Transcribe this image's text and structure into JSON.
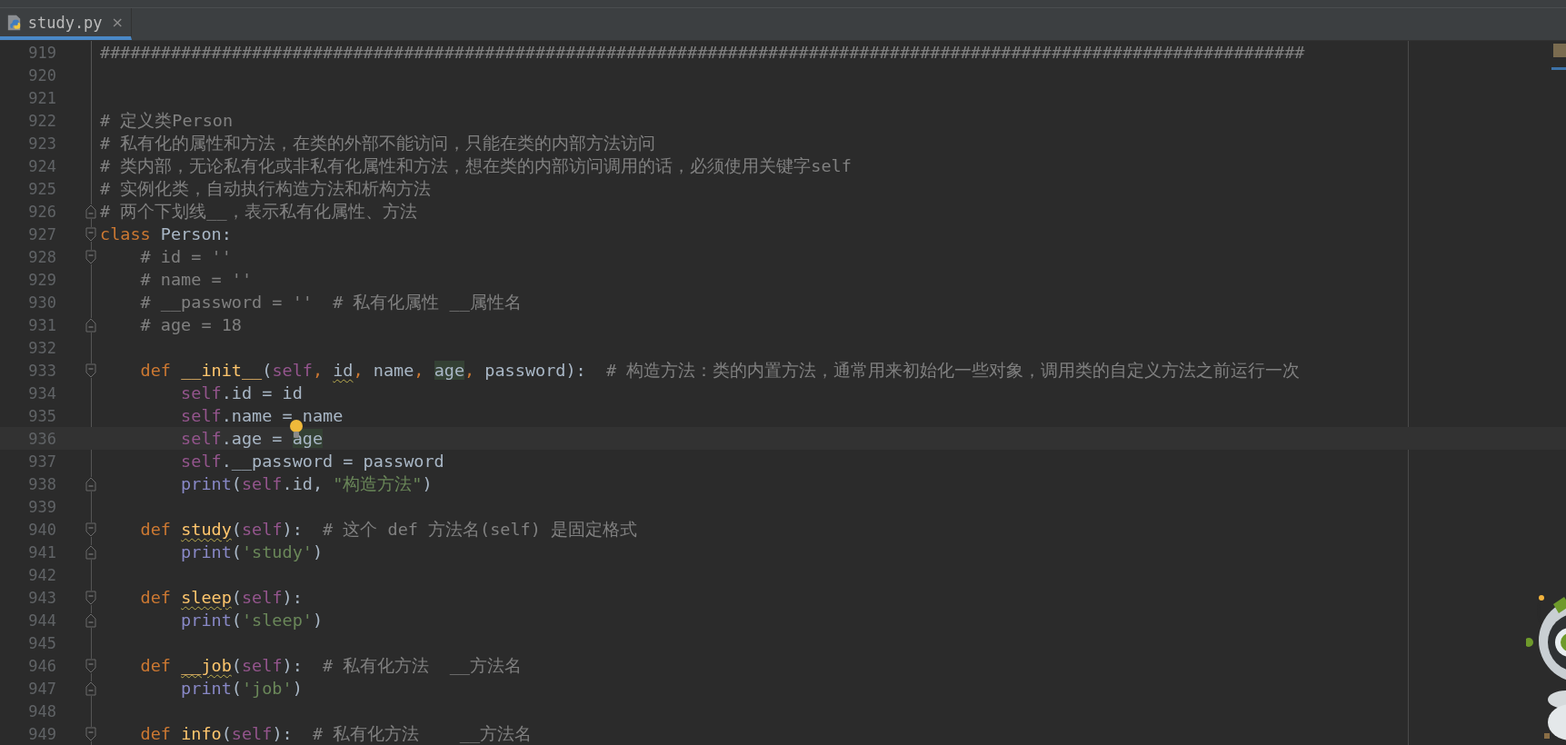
{
  "tabs": [
    {
      "label": "study.py",
      "selected": true,
      "close": "×"
    }
  ],
  "lines": [
    {
      "number": "919",
      "current": false,
      "tokens": [
        {
          "t": "#######################################################################################################################",
          "kind": "comment"
        }
      ]
    },
    {
      "number": "920",
      "current": false
    },
    {
      "number": "921",
      "current": false
    },
    {
      "number": "922",
      "current": false,
      "tokens": [
        {
          "t": "# 定义类Person",
          "kind": "comment"
        }
      ]
    },
    {
      "number": "923",
      "current": false,
      "tokens": [
        {
          "t": "# 私有化的属性和方法，在类的外部不能访问，只能在类的内部方法访问",
          "kind": "comment"
        }
      ]
    },
    {
      "number": "924",
      "current": false,
      "tokens": [
        {
          "t": "# 类内部，无论私有化或非私有化属性和方法，想在类的内部访问调用的话，必须使用关键字self",
          "kind": "comment"
        }
      ]
    },
    {
      "number": "925",
      "current": false,
      "tokens": [
        {
          "t": "# 实例化类，自动执行构造方法和析构方法",
          "kind": "comment"
        }
      ]
    },
    {
      "number": "926",
      "current": false,
      "fold": {
        "kind": "end"
      },
      "tokens": [
        {
          "t": "# 两个下划线__，表示私有化属性、方法",
          "kind": "comment"
        }
      ]
    },
    {
      "number": "927",
      "current": false,
      "fold": {
        "kind": "start"
      },
      "tokens": [
        {
          "t": "class",
          "kind": "keyword"
        },
        {
          "t": " Person:",
          "kind": "text"
        }
      ]
    },
    {
      "number": "928",
      "current": false,
      "fold": {
        "kind": "start"
      },
      "tokens": [
        {
          "t": "    # id = ''",
          "kind": "comment"
        }
      ]
    },
    {
      "number": "929",
      "current": false,
      "tokens": [
        {
          "t": "    # name = ''",
          "kind": "comment"
        }
      ]
    },
    {
      "number": "930",
      "current": false,
      "tokens": [
        {
          "t": "    # __password = ''  # 私有化属性 __属性名",
          "kind": "comment"
        }
      ]
    },
    {
      "number": "931",
      "current": false,
      "fold": {
        "kind": "end"
      },
      "tokens": [
        {
          "t": "    # age = 18",
          "kind": "comment"
        }
      ]
    },
    {
      "number": "932",
      "current": false
    },
    {
      "number": "933",
      "current": false,
      "fold": {
        "kind": "start"
      },
      "tokens": [
        {
          "t": "    def ",
          "kind": "keyword"
        },
        {
          "t": "__init__",
          "kind": "function"
        },
        {
          "t": "(",
          "kind": "text"
        },
        {
          "t": "self",
          "kind": "self"
        },
        {
          "t": ", ",
          "kind": "keyword"
        },
        {
          "t": "id",
          "kind": "text",
          "warning": true
        },
        {
          "t": ", ",
          "kind": "keyword"
        },
        {
          "t": "name",
          "kind": "text"
        },
        {
          "t": ", ",
          "kind": "keyword"
        },
        {
          "t": "age",
          "kind": "text",
          "usage": true
        },
        {
          "t": ", ",
          "kind": "keyword"
        },
        {
          "t": "password):  ",
          "kind": "text"
        },
        {
          "t": "# 构造方法：类的内置方法，通常用来初始化一些对象，调用类的自定义方法之前运行一次",
          "kind": "comment"
        }
      ]
    },
    {
      "number": "934",
      "current": false,
      "tokens": [
        {
          "t": "        self",
          "kind": "self"
        },
        {
          "t": ".id = id",
          "kind": "text"
        }
      ]
    },
    {
      "number": "935",
      "current": false,
      "tokens": [
        {
          "t": "        self",
          "kind": "self"
        },
        {
          "t": ".name = name",
          "kind": "text"
        }
      ]
    },
    {
      "number": "936",
      "current": true,
      "bulb": true,
      "tokens": [
        {
          "t": "        self",
          "kind": "self"
        },
        {
          "t": ".age = ",
          "kind": "text"
        },
        {
          "t": "age",
          "kind": "text",
          "usage": true
        }
      ]
    },
    {
      "number": "937",
      "current": false,
      "tokens": [
        {
          "t": "        self",
          "kind": "self"
        },
        {
          "t": ".__password = password",
          "kind": "text"
        }
      ]
    },
    {
      "number": "938",
      "current": false,
      "fold": {
        "kind": "end"
      },
      "tokens": [
        {
          "t": "        print",
          "kind": "builtin"
        },
        {
          "t": "(",
          "kind": "text"
        },
        {
          "t": "self",
          "kind": "self"
        },
        {
          "t": ".id, ",
          "kind": "text"
        },
        {
          "t": "\"构造方法\"",
          "kind": "string"
        },
        {
          "t": ")",
          "kind": "text"
        }
      ]
    },
    {
      "number": "939",
      "current": false
    },
    {
      "number": "940",
      "current": false,
      "fold": {
        "kind": "start"
      },
      "tokens": [
        {
          "t": "    def ",
          "kind": "keyword"
        },
        {
          "t": "study",
          "kind": "function",
          "warning": true
        },
        {
          "t": "(",
          "kind": "text"
        },
        {
          "t": "self",
          "kind": "self"
        },
        {
          "t": "):  ",
          "kind": "text"
        },
        {
          "t": "# 这个 def 方法名(self) 是固定格式",
          "kind": "comment"
        }
      ]
    },
    {
      "number": "941",
      "current": false,
      "fold": {
        "kind": "end"
      },
      "tokens": [
        {
          "t": "        print",
          "kind": "builtin"
        },
        {
          "t": "(",
          "kind": "text"
        },
        {
          "t": "'study'",
          "kind": "string"
        },
        {
          "t": ")",
          "kind": "text"
        }
      ]
    },
    {
      "number": "942",
      "current": false
    },
    {
      "number": "943",
      "current": false,
      "fold": {
        "kind": "start"
      },
      "tokens": [
        {
          "t": "    def ",
          "kind": "keyword"
        },
        {
          "t": "sleep",
          "kind": "function",
          "warning": true
        },
        {
          "t": "(",
          "kind": "text"
        },
        {
          "t": "self",
          "kind": "self"
        },
        {
          "t": "):",
          "kind": "text"
        }
      ]
    },
    {
      "number": "944",
      "current": false,
      "fold": {
        "kind": "end"
      },
      "tokens": [
        {
          "t": "        print",
          "kind": "builtin"
        },
        {
          "t": "(",
          "kind": "text"
        },
        {
          "t": "'sleep'",
          "kind": "string"
        },
        {
          "t": ")",
          "kind": "text"
        }
      ]
    },
    {
      "number": "945",
      "current": false
    },
    {
      "number": "946",
      "current": false,
      "fold": {
        "kind": "start"
      },
      "tokens": [
        {
          "t": "    def ",
          "kind": "keyword"
        },
        {
          "t": "__job",
          "kind": "function",
          "warning": true
        },
        {
          "t": "(",
          "kind": "text"
        },
        {
          "t": "self",
          "kind": "self"
        },
        {
          "t": "):  ",
          "kind": "text"
        },
        {
          "t": "# 私有化方法  __方法名",
          "kind": "comment"
        }
      ]
    },
    {
      "number": "947",
      "current": false,
      "fold": {
        "kind": "end"
      },
      "tokens": [
        {
          "t": "        print",
          "kind": "builtin"
        },
        {
          "t": "(",
          "kind": "text"
        },
        {
          "t": "'job'",
          "kind": "string"
        },
        {
          "t": ")",
          "kind": "text"
        }
      ]
    },
    {
      "number": "948",
      "current": false
    },
    {
      "number": "949",
      "current": false,
      "fold": {
        "kind": "start"
      },
      "tokens": [
        {
          "t": "    def ",
          "kind": "keyword"
        },
        {
          "t": "info",
          "kind": "function"
        },
        {
          "t": "(",
          "kind": "text"
        },
        {
          "t": "self",
          "kind": "self"
        },
        {
          "t": "):  ",
          "kind": "text"
        },
        {
          "t": "# 私有化方法    __方法名",
          "kind": "comment"
        }
      ]
    }
  ]
}
